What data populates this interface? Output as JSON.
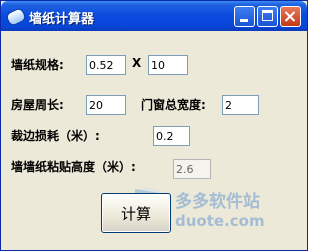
{
  "window": {
    "title": "墙纸计算器"
  },
  "form": {
    "spec_label": "墙纸规格:",
    "width_value": "0.52",
    "x_label": "X",
    "length_value": "10",
    "perimeter_label": "房屋周长:",
    "perimeter_value": "20",
    "window_width_label": "门窗总宽度:",
    "window_width_value": "2",
    "trim_loss_label": "裁边损耗（米）:",
    "trim_loss_value": "0.2",
    "paste_height_label": "墙墙纸粘贴高度（米）:",
    "paste_height_value": "2.6"
  },
  "actions": {
    "calculate_label": "计算"
  },
  "watermark": {
    "line1": "多多软件站",
    "line2": "duote.com"
  },
  "colors": {
    "titlebar": "#0a4ae0",
    "face": "#ECE9D8",
    "close": "#c23a16"
  }
}
